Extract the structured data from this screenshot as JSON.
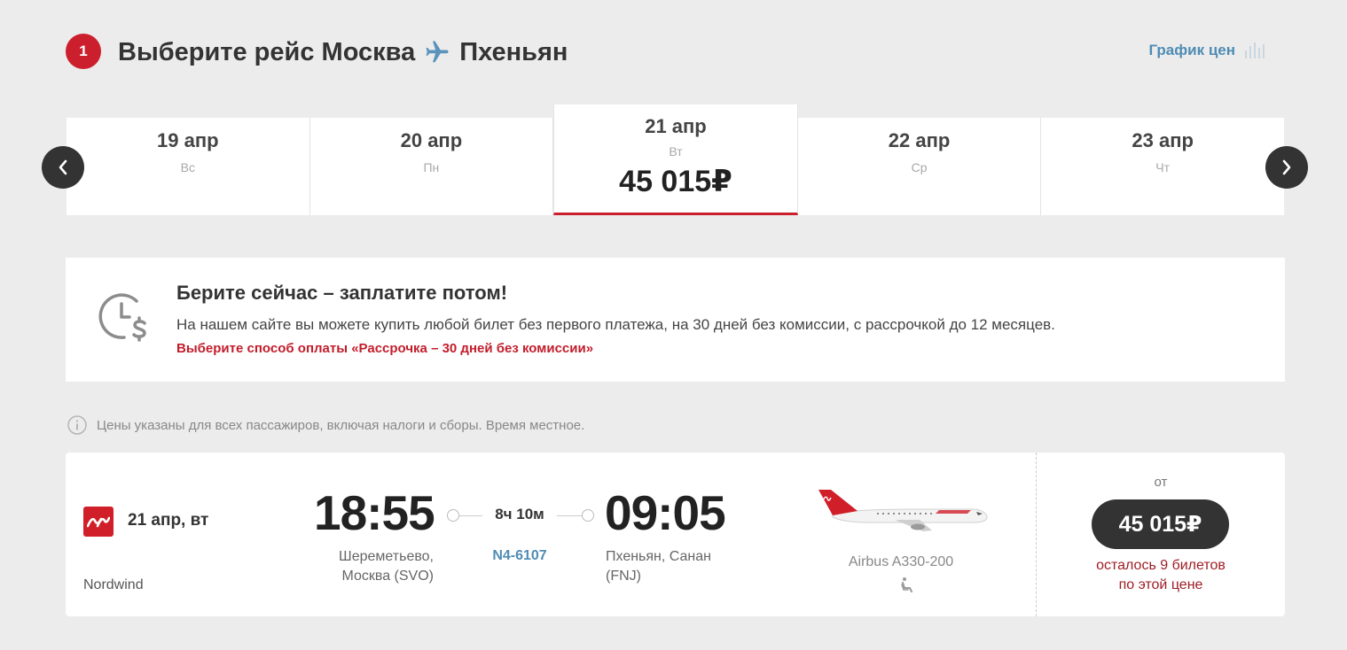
{
  "header": {
    "step_number": "1",
    "title_prefix": "Выберите рейс Москва",
    "title_destination": "Пхеньян",
    "price_graph_label": "График цен"
  },
  "dates": [
    {
      "date": "19 апр",
      "weekday": "Вс"
    },
    {
      "date": "20 апр",
      "weekday": "Пн"
    },
    {
      "date": "21 апр",
      "weekday": "Вт",
      "price": "45 015₽",
      "selected": true
    },
    {
      "date": "22 апр",
      "weekday": "Ср"
    },
    {
      "date": "23 апр",
      "weekday": "Чт"
    }
  ],
  "promo": {
    "title": "Берите сейчас – заплатите потом!",
    "text": "На нашем сайте вы можете купить любой билет без первого платежа, на 30 дней без комиссии, с рассрочкой до 12 месяцев.",
    "link": "Выберите способ оплаты «Рассрочка – 30 дней без комиссии»"
  },
  "notice": "Цены указаны для всех пассажиров, включая налоги и сборы. Время местное.",
  "flight": {
    "date": "21 апр, вт",
    "airline": "Nordwind",
    "departure_time": "18:55",
    "departure_airport_line1": "Шереметьево,",
    "departure_airport_line2": "Москва (SVO)",
    "duration": "8ч 10м",
    "flight_number": "N4-6107",
    "arrival_time": "09:05",
    "arrival_airport_line1": "Пхеньян, Санан",
    "arrival_airport_line2": "(FNJ)",
    "aircraft": "Airbus A330-200",
    "price_from_label": "от",
    "price": "45 015₽",
    "seats_left_line1": "осталось 9 билетов",
    "seats_left_line2": "по этой цене"
  },
  "colors": {
    "accent_red": "#cc1f2d",
    "link_blue": "#4f8cb4",
    "dark": "#333333",
    "background": "#ececec"
  },
  "icons": {
    "plane": "plane-icon",
    "bars": "bar-chart-icon",
    "prev": "chevron-left-icon",
    "next": "chevron-right-icon",
    "clock_dollar": "clock-dollar-icon",
    "info": "info-icon",
    "seat": "seat-icon"
  }
}
